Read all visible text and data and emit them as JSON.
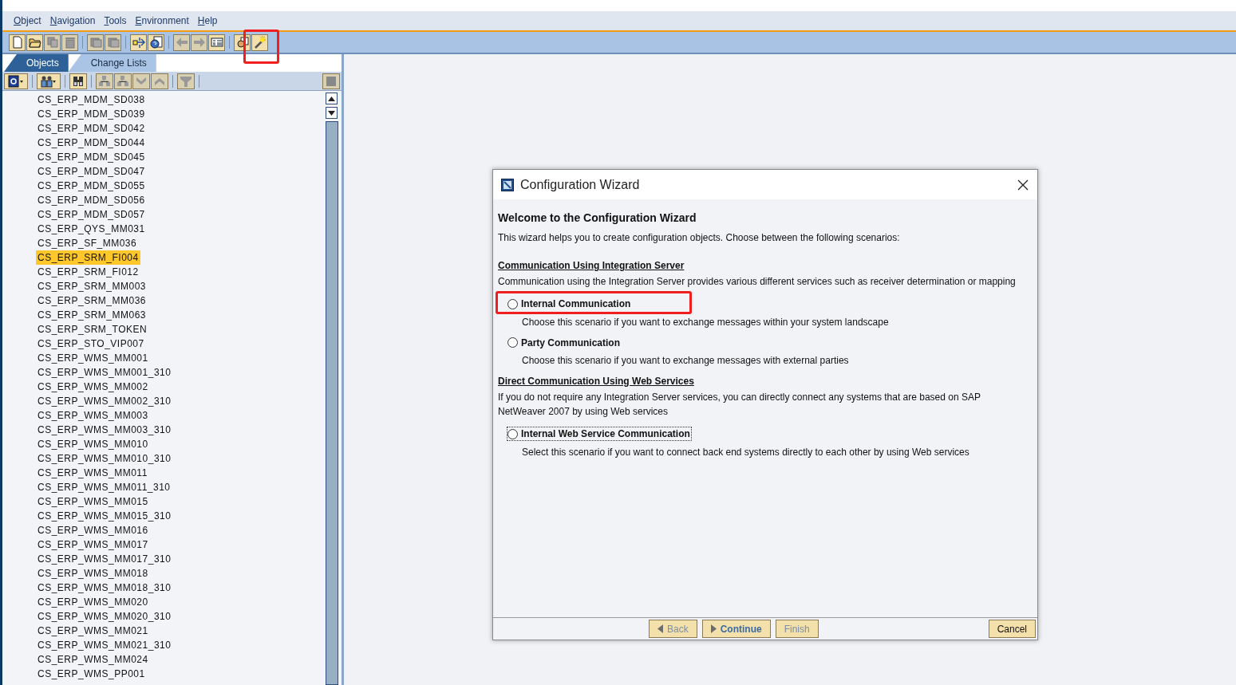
{
  "menu": [
    {
      "label": "Object"
    },
    {
      "label": "Navigation"
    },
    {
      "label": "Tools"
    },
    {
      "label": "Environment"
    },
    {
      "label": "Help"
    }
  ],
  "toolbar": [
    {
      "kind": "new",
      "disabled": false
    },
    {
      "kind": "open",
      "disabled": false
    },
    {
      "kind": "copy",
      "disabled": true
    },
    {
      "kind": "delete",
      "disabled": true
    },
    {
      "kind": "sep"
    },
    {
      "kind": "stack",
      "disabled": true
    },
    {
      "kind": "stack",
      "disabled": true
    },
    {
      "kind": "sep"
    },
    {
      "kind": "transfer",
      "disabled": false
    },
    {
      "kind": "help",
      "disabled": false
    },
    {
      "kind": "sep"
    },
    {
      "kind": "back",
      "disabled": true
    },
    {
      "kind": "forward",
      "disabled": true
    },
    {
      "kind": "list",
      "disabled": false
    },
    {
      "kind": "sep"
    },
    {
      "kind": "person",
      "disabled": false
    },
    {
      "kind": "wand",
      "disabled": false,
      "highlighted": true
    }
  ],
  "tabs": [
    {
      "label": "Objects",
      "selected": true
    },
    {
      "label": "Change Lists",
      "selected": false
    }
  ],
  "panel_toolbar": [
    {
      "kind": "refresh",
      "disabled": false
    },
    {
      "kind": "sep"
    },
    {
      "kind": "people",
      "disabled": false
    },
    {
      "kind": "sep"
    },
    {
      "kind": "binoculars",
      "disabled": false
    },
    {
      "kind": "sep"
    },
    {
      "kind": "expand",
      "disabled": true
    },
    {
      "kind": "collapse",
      "disabled": true
    },
    {
      "kind": "down",
      "disabled": true
    },
    {
      "kind": "up",
      "disabled": true
    },
    {
      "kind": "sep"
    },
    {
      "kind": "filter",
      "disabled": true
    },
    {
      "kind": "sep"
    }
  ],
  "objects": [
    {
      "label": "CS_ERP_MDM_SD038",
      "selected": false
    },
    {
      "label": "CS_ERP_MDM_SD039",
      "selected": false
    },
    {
      "label": "CS_ERP_MDM_SD042",
      "selected": false
    },
    {
      "label": "CS_ERP_MDM_SD044",
      "selected": false
    },
    {
      "label": "CS_ERP_MDM_SD045",
      "selected": false
    },
    {
      "label": "CS_ERP_MDM_SD047",
      "selected": false
    },
    {
      "label": "CS_ERP_MDM_SD055",
      "selected": false
    },
    {
      "label": "CS_ERP_MDM_SD056",
      "selected": false
    },
    {
      "label": "CS_ERP_MDM_SD057",
      "selected": false
    },
    {
      "label": "CS_ERP_QYS_MM031",
      "selected": false
    },
    {
      "label": "CS_ERP_SF_MM036",
      "selected": false
    },
    {
      "label": "CS_ERP_SRM_FI004",
      "selected": true
    },
    {
      "label": "CS_ERP_SRM_FI012",
      "selected": false
    },
    {
      "label": "CS_ERP_SRM_MM003",
      "selected": false
    },
    {
      "label": "CS_ERP_SRM_MM036",
      "selected": false
    },
    {
      "label": "CS_ERP_SRM_MM063",
      "selected": false
    },
    {
      "label": "CS_ERP_SRM_TOKEN",
      "selected": false
    },
    {
      "label": "CS_ERP_STO_VIP007",
      "selected": false
    },
    {
      "label": "CS_ERP_WMS_MM001",
      "selected": false
    },
    {
      "label": "CS_ERP_WMS_MM001_310",
      "selected": false
    },
    {
      "label": "CS_ERP_WMS_MM002",
      "selected": false
    },
    {
      "label": "CS_ERP_WMS_MM002_310",
      "selected": false
    },
    {
      "label": "CS_ERP_WMS_MM003",
      "selected": false
    },
    {
      "label": "CS_ERP_WMS_MM003_310",
      "selected": false
    },
    {
      "label": "CS_ERP_WMS_MM010",
      "selected": false
    },
    {
      "label": "CS_ERP_WMS_MM010_310",
      "selected": false
    },
    {
      "label": "CS_ERP_WMS_MM011",
      "selected": false
    },
    {
      "label": "CS_ERP_WMS_MM011_310",
      "selected": false
    },
    {
      "label": "CS_ERP_WMS_MM015",
      "selected": false
    },
    {
      "label": "CS_ERP_WMS_MM015_310",
      "selected": false
    },
    {
      "label": "CS_ERP_WMS_MM016",
      "selected": false
    },
    {
      "label": "CS_ERP_WMS_MM017",
      "selected": false
    },
    {
      "label": "CS_ERP_WMS_MM017_310",
      "selected": false
    },
    {
      "label": "CS_ERP_WMS_MM018",
      "selected": false
    },
    {
      "label": "CS_ERP_WMS_MM018_310",
      "selected": false
    },
    {
      "label": "CS_ERP_WMS_MM020",
      "selected": false
    },
    {
      "label": "CS_ERP_WMS_MM020_310",
      "selected": false
    },
    {
      "label": "CS_ERP_WMS_MM021",
      "selected": false
    },
    {
      "label": "CS_ERP_WMS_MM021_310",
      "selected": false
    },
    {
      "label": "CS_ERP_WMS_MM024",
      "selected": false
    },
    {
      "label": "CS_ERP_WMS_PP001",
      "selected": false
    }
  ],
  "dialog": {
    "title": "Configuration Wizard",
    "heading": "Welcome to the Configuration Wizard",
    "intro": "This wizard helps you to create configuration objects. Choose between the following scenarios:",
    "sections": [
      {
        "title": "Communication Using Integration Server",
        "text": "Communication using the Integration Server provides various different services such as receiver determination or mapping",
        "options": [
          {
            "label": "Internal Communication",
            "description": "Choose this scenario if you want to exchange messages within your system landscape",
            "selected": false,
            "focused": false,
            "highlighted": true
          },
          {
            "label": "Party Communication",
            "description": "Choose this scenario if you want to exchange messages with external parties",
            "selected": false,
            "focused": false,
            "highlighted": false
          }
        ]
      },
      {
        "title": "Direct Communication Using Web Services",
        "text": "If you do not require any Integration Server services, you can directly connect any systems that are based on SAP NetWeaver 2007 by using Web services",
        "options": [
          {
            "label": "Internal Web Service Communication",
            "description": "Select this scenario if you want to connect back end systems directly to each other by using Web services",
            "selected": false,
            "focused": true,
            "highlighted": false
          }
        ]
      }
    ],
    "buttons": [
      {
        "label": "Back",
        "kind": "back",
        "disabled": true,
        "primary": false
      },
      {
        "label": "Continue",
        "kind": "forward",
        "disabled": false,
        "primary": true
      },
      {
        "label": "Finish",
        "kind": "plain",
        "disabled": true,
        "primary": false
      },
      {
        "label": "Cancel",
        "kind": "cancel",
        "disabled": false,
        "primary": false
      }
    ]
  }
}
